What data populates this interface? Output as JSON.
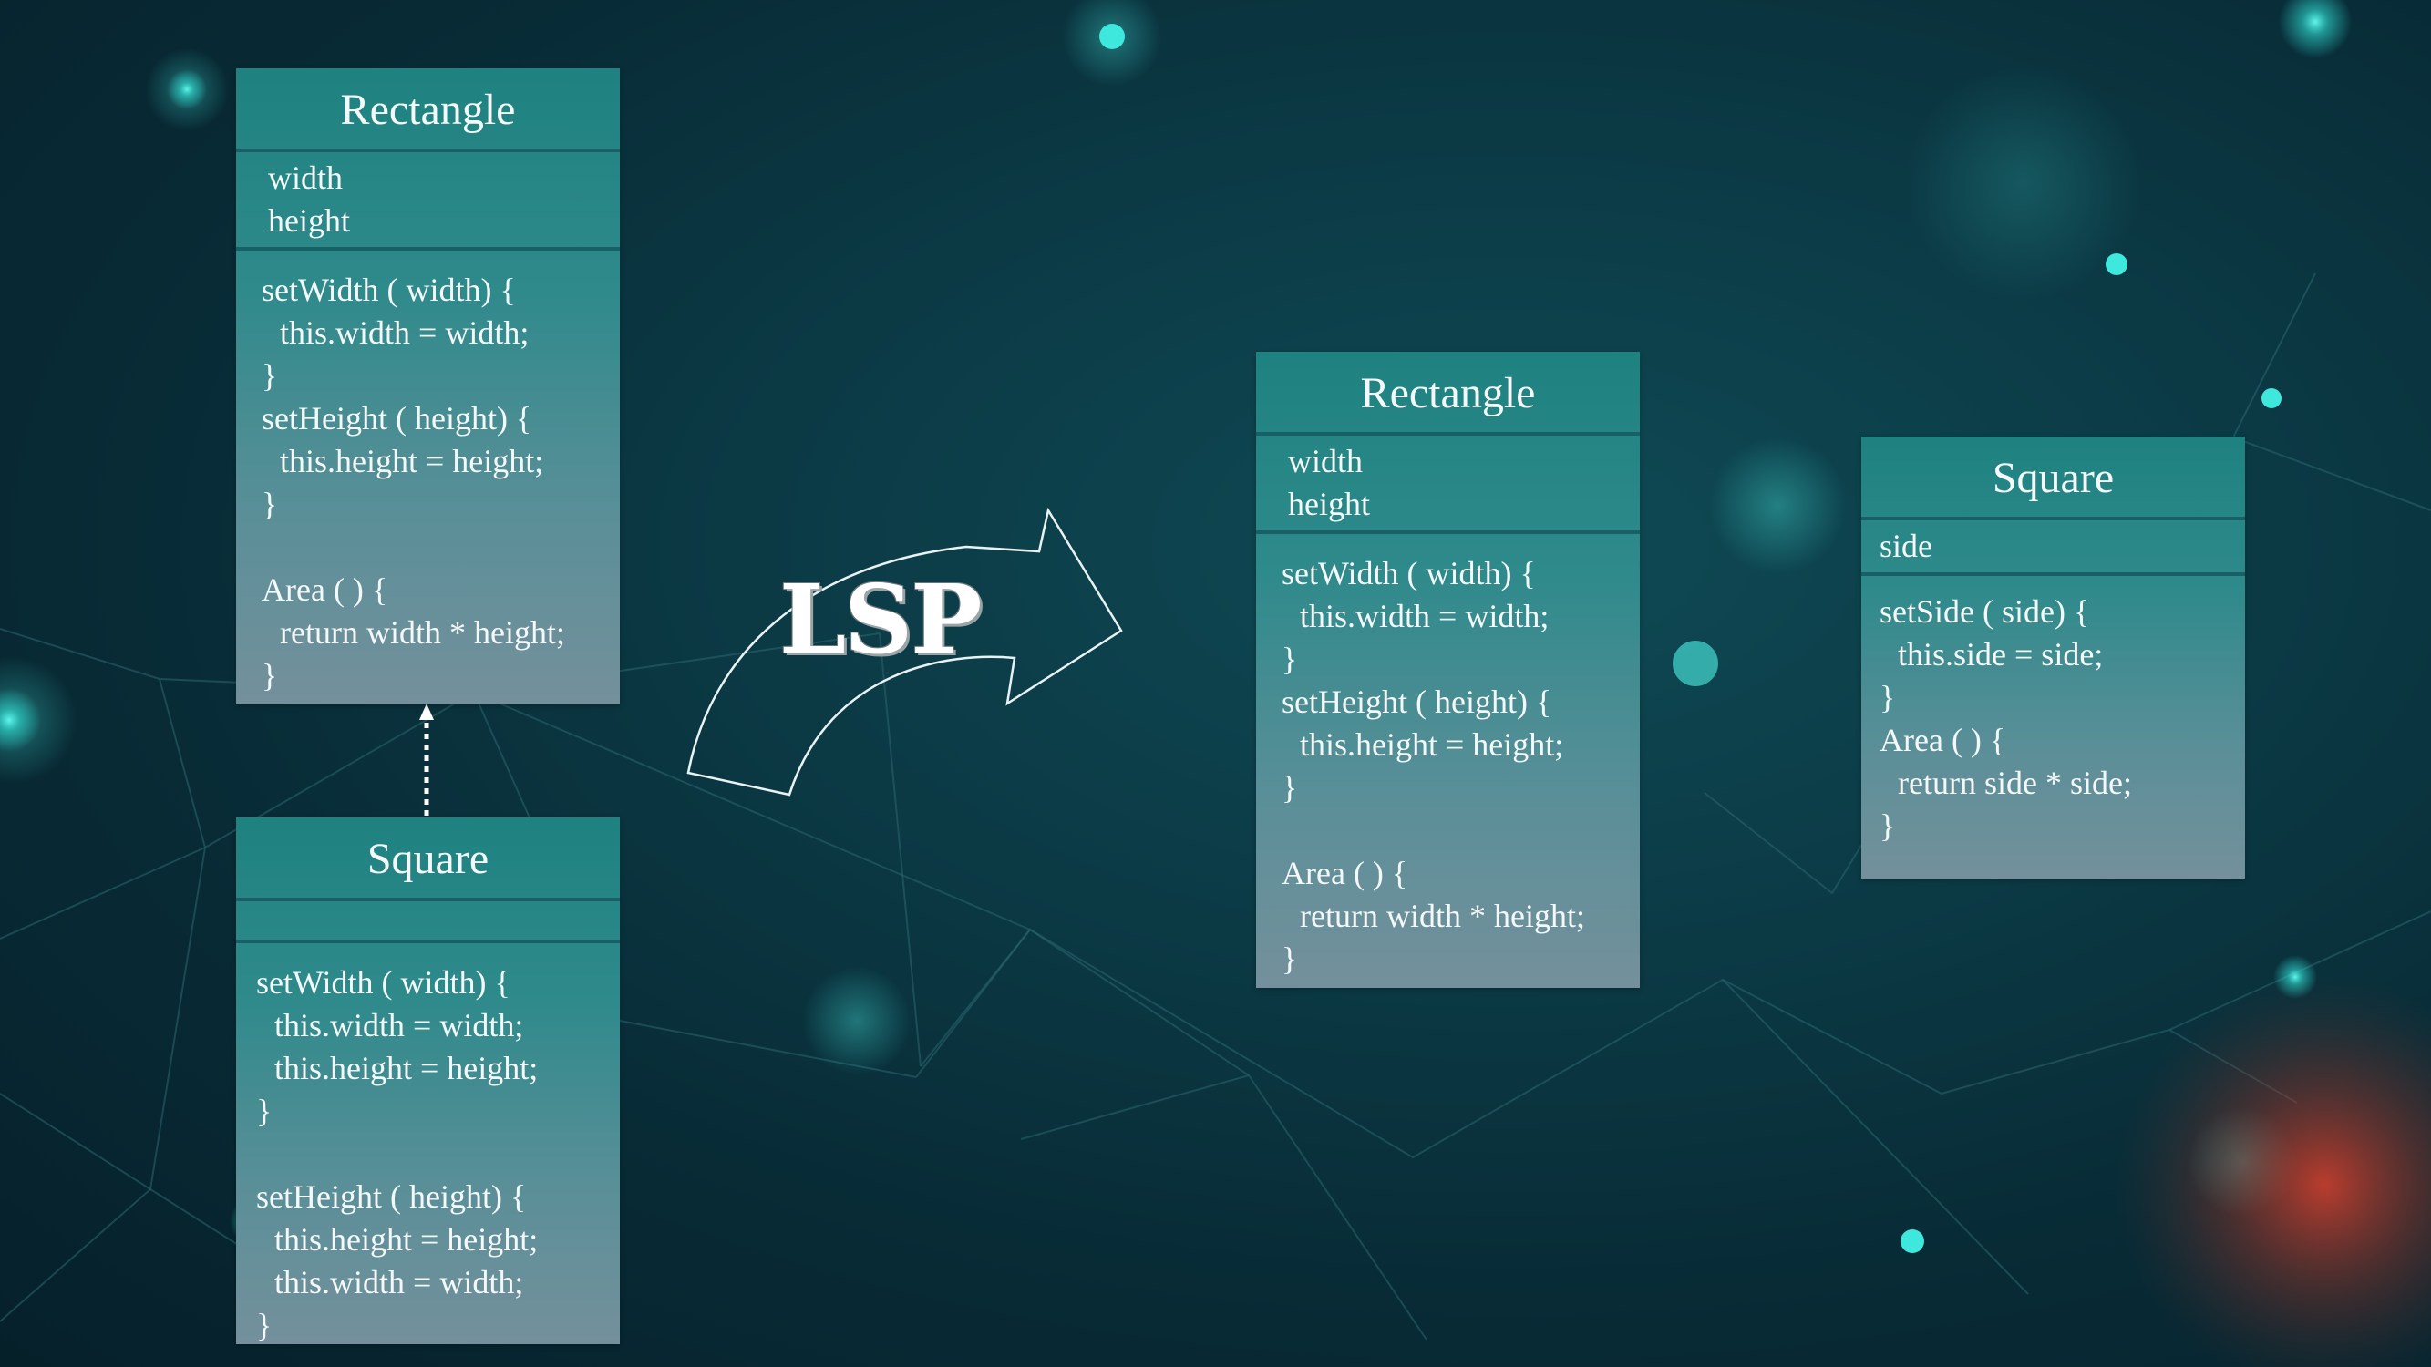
{
  "diagrams": {
    "left_rectangle": {
      "title": "Rectangle",
      "attributes": [
        "width",
        "height"
      ],
      "operations": [
        "setWidth ( width) {",
        "this.width = width;",
        "}",
        "setHeight ( height) {",
        "this.height = height;",
        "}",
        "",
        "Area ( ) {",
        "return width * height;",
        "}"
      ]
    },
    "left_square": {
      "title": "Square",
      "attributes": [],
      "operations": [
        "setWidth ( width) {",
        "this.width = width;",
        "this.height = height;",
        "}",
        "",
        "setHeight ( height) {",
        "this.height = height;",
        "this.width = width;",
        "}"
      ]
    },
    "right_rectangle": {
      "title": "Rectangle",
      "attributes": [
        "width",
        "height"
      ],
      "operations": [
        "setWidth ( width) {",
        "this.width = width;",
        "}",
        "setHeight ( height) {",
        "this.height = height;",
        "}",
        "",
        "Area ( ) {",
        "return width * height;",
        "}"
      ]
    },
    "right_square": {
      "title": "Square",
      "attributes": [
        "side"
      ],
      "operations": [
        "setSide ( side) {",
        "this.side = side;",
        "}",
        "Area ( ) {",
        "return side * side;",
        "}"
      ]
    }
  },
  "arrow_label": "LSP",
  "colors": {
    "box_top": "#1e8280",
    "box_bottom": "#74909c",
    "divider": "#185f66",
    "background": "#0b3a45",
    "glow": "#2fe0d6",
    "accent_red": "#c03a2b"
  }
}
